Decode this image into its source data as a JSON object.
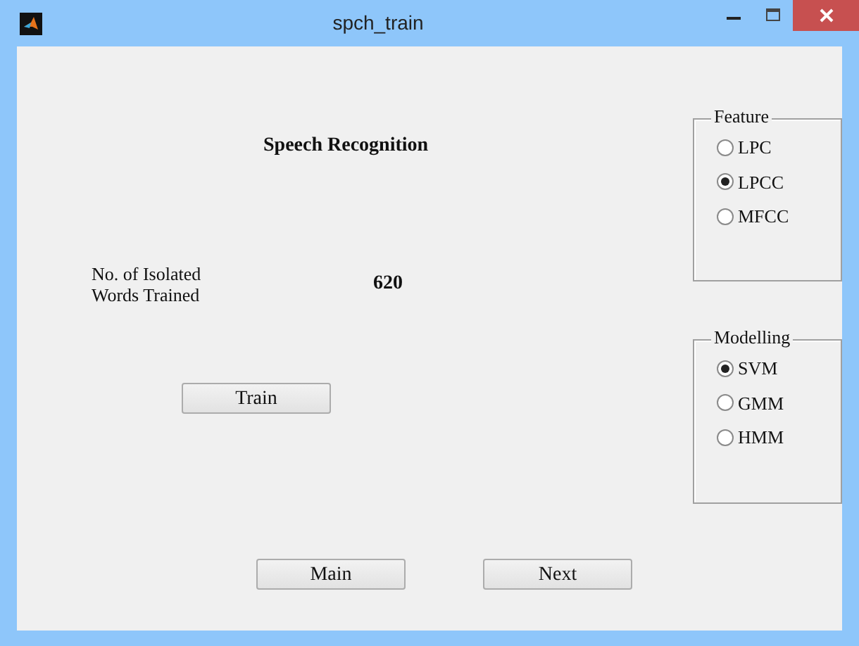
{
  "window": {
    "title": "spch_train"
  },
  "heading": "Speech Recognition",
  "count_label": "No. of Isolated Words Trained",
  "count_value": "620",
  "train_button": "Train",
  "groups": [
    {
      "title": "Feature",
      "options": [
        {
          "label": "LPC",
          "selected": false
        },
        {
          "label": "LPCC",
          "selected": true
        },
        {
          "label": "MFCC",
          "selected": false
        }
      ]
    },
    {
      "title": "Modelling",
      "options": [
        {
          "label": "SVM",
          "selected": true
        },
        {
          "label": "GMM",
          "selected": false
        },
        {
          "label": "HMM",
          "selected": false
        }
      ]
    }
  ],
  "buttons": [
    "Main",
    "Next"
  ]
}
